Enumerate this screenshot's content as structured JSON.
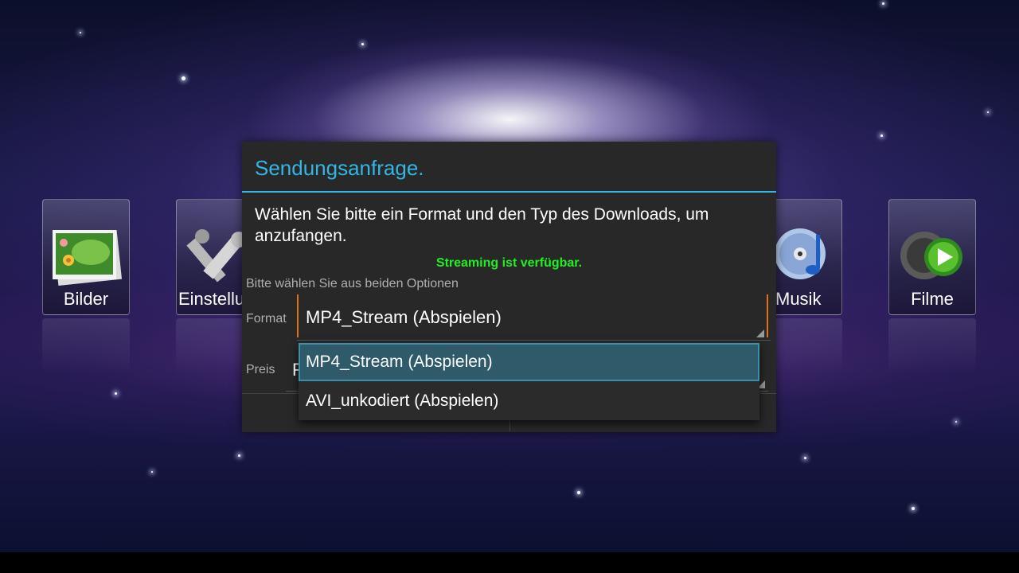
{
  "launcher": {
    "tiles": [
      {
        "label": "Bilder",
        "icon": "photos-icon"
      },
      {
        "label": "Einstellu",
        "icon": "settings-tools-icon"
      },
      {
        "label": "Musik",
        "icon": "music-cd-icon"
      },
      {
        "label": "Filme",
        "icon": "film-reel-icon"
      }
    ]
  },
  "dialog": {
    "title": "Sendungsanfrage.",
    "message": "Wählen Sie bitte ein Format und den Typ des Downloads, um anzufangen.",
    "status": "Streaming ist verfügbar.",
    "hint": "Bitte wählen Sie aus beiden Optionen",
    "format_label": "Format",
    "format_value": "MP4_Stream (Abspielen)",
    "preis_label": "Preis",
    "preis_value": "F"
  },
  "dropdown": {
    "options": [
      "MP4_Stream (Abspielen)",
      "AVI_unkodiert (Abspielen)"
    ],
    "selected_index": 0
  },
  "colors": {
    "accent": "#33b5e5",
    "status_green": "#22ee22",
    "spinner_focus": "#d9731f",
    "selected_bg": "#2e5a6a"
  }
}
